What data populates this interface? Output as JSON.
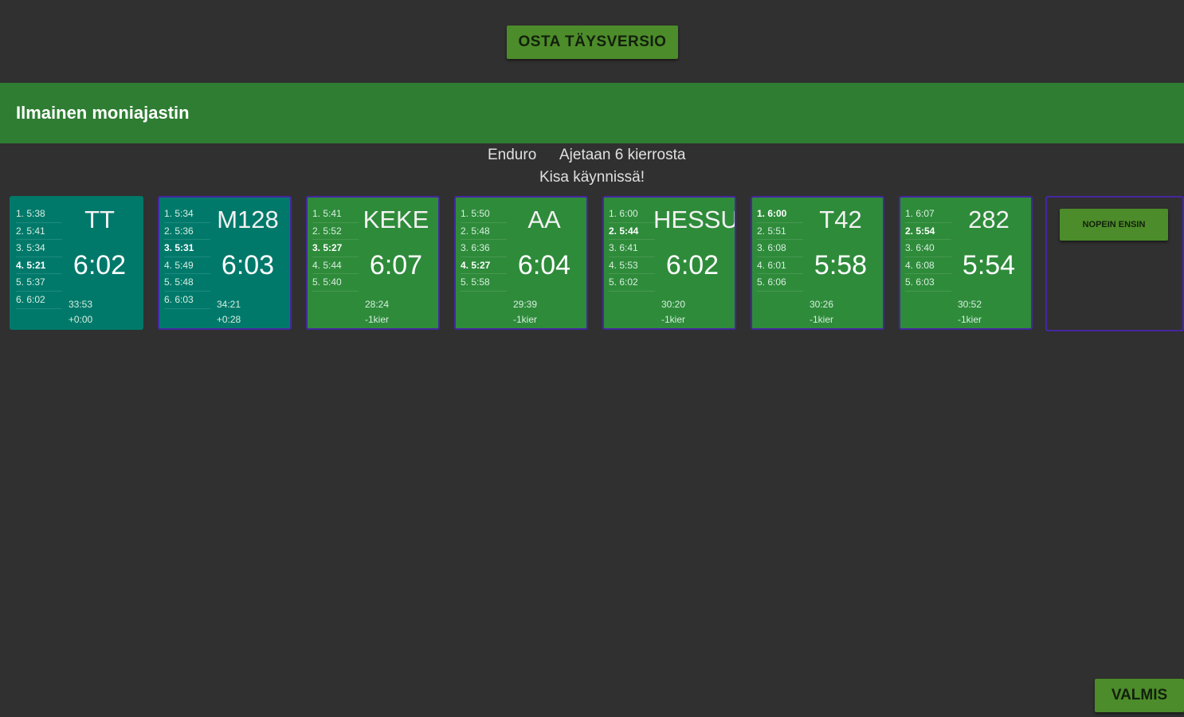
{
  "buy_button": "OSTA TÄYSVERSIO",
  "app_title": "Ilmainen moniajastin",
  "race": {
    "type": "Enduro",
    "laps_info": "Ajetaan 6 kierrosta",
    "status": "Kisa käynnissä!"
  },
  "colors": {
    "background": "#303030",
    "app_bar": "#2e7d32",
    "card_leader": "#00796b",
    "card_other": "#2e8b3a",
    "button": "#4c8c2a",
    "border": "#4527a0"
  },
  "riders": [
    {
      "name": "TT",
      "last_lap": "6:02",
      "total": "33:53",
      "diff": "+0:00",
      "laps": [
        "1. 5:38",
        "2. 5:41",
        "3. 5:34",
        "4. 5:21",
        "5. 5:37",
        "6. 6:02"
      ]
    },
    {
      "name": "M128",
      "last_lap": "6:03",
      "total": "34:21",
      "diff": "+0:28",
      "laps": [
        "1. 5:34",
        "2. 5:36",
        "3. 5:31",
        "4. 5:49",
        "5. 5:48",
        "6. 6:03"
      ]
    },
    {
      "name": "KEKE",
      "last_lap": "6:07",
      "total": "28:24",
      "diff": "-1kier",
      "laps": [
        "1. 5:41",
        "2. 5:52",
        "3. 5:27",
        "4. 5:44",
        "5. 5:40"
      ]
    },
    {
      "name": "AA",
      "last_lap": "6:04",
      "total": "29:39",
      "diff": "-1kier",
      "laps": [
        "1. 5:50",
        "2. 5:48",
        "3. 6:36",
        "4. 5:27",
        "5. 5:58"
      ]
    },
    {
      "name": "HESSU",
      "last_lap": "6:02",
      "total": "30:20",
      "diff": "-1kier",
      "laps": [
        "1. 6:00",
        "2. 5:44",
        "3. 6:41",
        "4. 5:53",
        "5. 6:02"
      ]
    },
    {
      "name": "T42",
      "last_lap": "5:58",
      "total": "30:26",
      "diff": "-1kier",
      "laps": [
        "1. 6:00",
        "2. 5:51",
        "3. 6:08",
        "4. 6:01",
        "5. 6:06"
      ]
    },
    {
      "name": "282",
      "last_lap": "5:54",
      "total": "30:52",
      "diff": "-1kier",
      "laps": [
        "1. 6:07",
        "2. 5:54",
        "3. 6:40",
        "4. 6:08",
        "5. 6:03"
      ]
    }
  ],
  "sort_button": "NOPEIN ENSIN",
  "done_button": "VALMIS"
}
